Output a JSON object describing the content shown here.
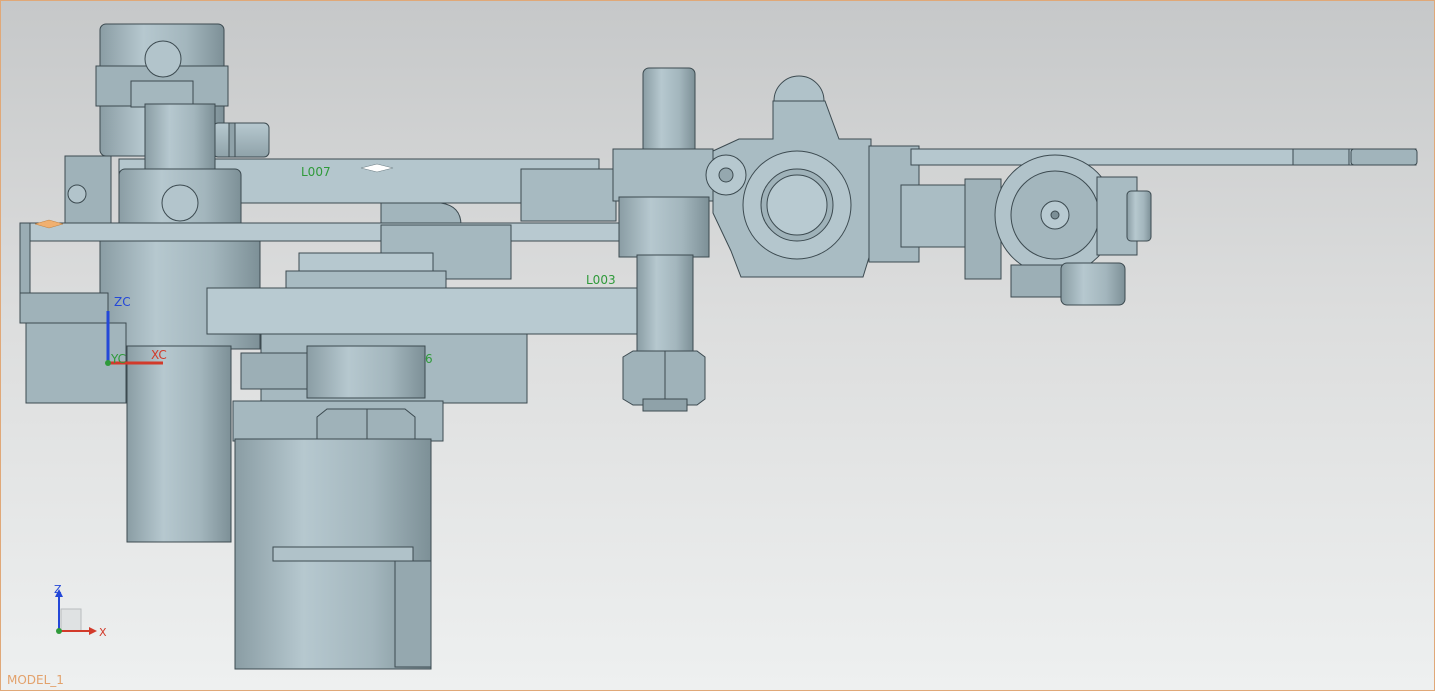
{
  "viewport": {
    "model_name": "MODEL_1",
    "border_color": "#e0a878"
  },
  "labels": {
    "link_top": "L007",
    "link_middle": "L003",
    "partial_label": "6"
  },
  "wcs": {
    "zc_label": "ZC",
    "xc_label": "XC",
    "yc_label": "YC"
  },
  "triad": {
    "z_label": "Z",
    "x_label": "X"
  },
  "colors": {
    "part_fill": "#a9bcc3",
    "part_dark": "#7c8f96",
    "part_edge": "#3c4a50",
    "label_green": "#2f9a3a",
    "axis_blue": "#2448d8",
    "axis_red": "#d23a2a"
  }
}
